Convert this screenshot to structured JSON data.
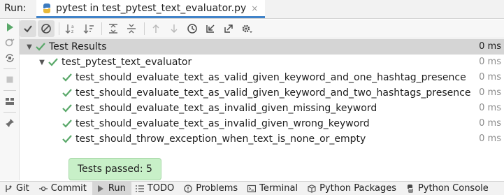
{
  "runbar": {
    "label": "Run:",
    "tab_title": "pytest in test_pytest_text_evaluator.py",
    "tab_close": "×"
  },
  "colors": {
    "pass_green": "#59a869",
    "tab_underline": "#4083c9",
    "tooltip_bg": "#c8f0c8",
    "selected_row": "#d5d5d5"
  },
  "tree": {
    "root": {
      "label": "Test Results",
      "duration": "0 ms"
    },
    "suite": {
      "label": "test_pytest_text_evaluator",
      "duration": "0 ms"
    },
    "tests": [
      {
        "label": "test_should_evaluate_text_as_valid_given_keyword_and_one_hashtag_presence",
        "duration": "0 ms"
      },
      {
        "label": "test_should_evaluate_text_as_valid_given_keyword_and_two_hashtags_presence",
        "duration": "0 ms"
      },
      {
        "label": "test_should_evaluate_text_as_invalid_given_missing_keyword",
        "duration": "0 ms"
      },
      {
        "label": "test_should_evaluate_text_as_invalid_given_wrong_keyword",
        "duration": "0 ms"
      },
      {
        "label": "test_should_throw_exception_when_text_is_none_or_empty",
        "duration": "0 ms"
      }
    ]
  },
  "tooltip": {
    "text": "Tests passed: 5"
  },
  "bottombar": {
    "items": [
      {
        "label": "Git",
        "icon": "git-branch-icon"
      },
      {
        "label": "Commit",
        "icon": "commit-icon"
      },
      {
        "label": "Run",
        "icon": "run-icon"
      },
      {
        "label": "TODO",
        "icon": "todo-list-icon"
      },
      {
        "label": "Problems",
        "icon": "problems-icon"
      },
      {
        "label": "Terminal",
        "icon": "terminal-icon"
      },
      {
        "label": "Python Packages",
        "icon": "packages-icon"
      },
      {
        "label": "Python Console",
        "icon": "python-console-icon"
      }
    ]
  }
}
